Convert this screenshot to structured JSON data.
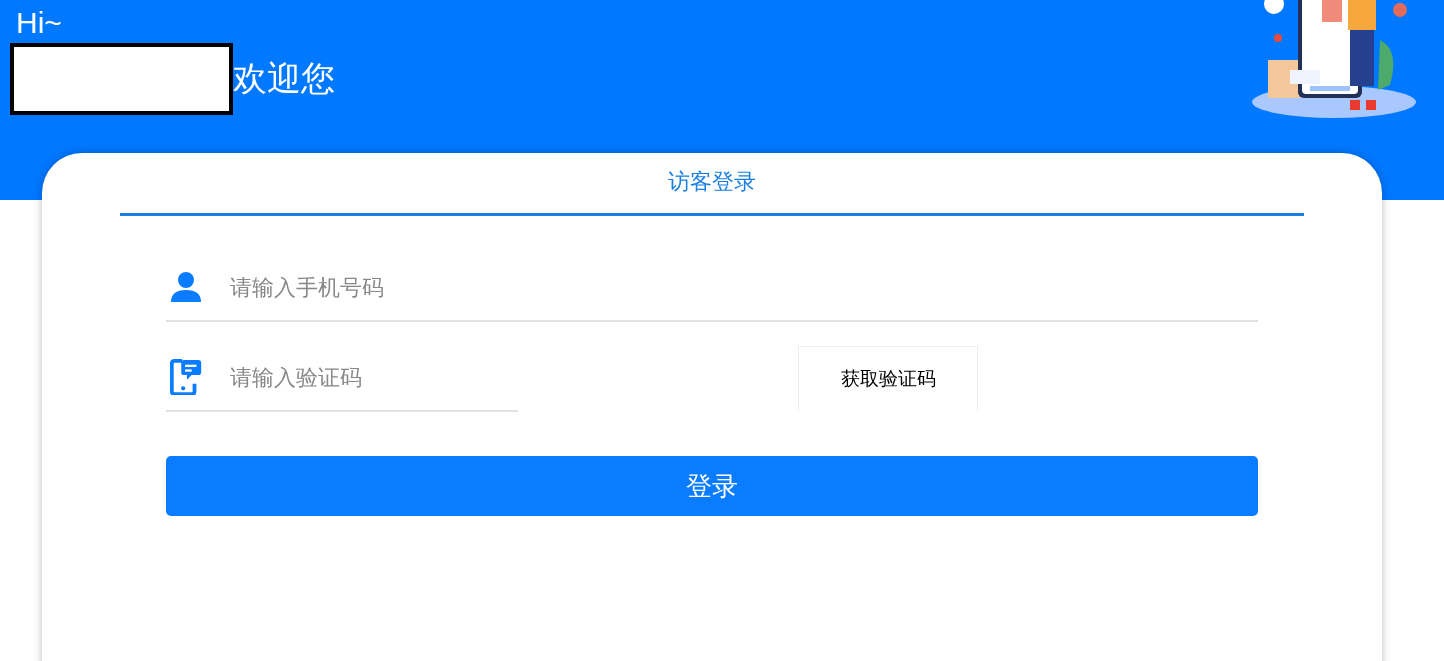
{
  "header": {
    "greeting": "Hi~",
    "welcome": "欢迎您"
  },
  "tabs": [
    {
      "label": "访客登录",
      "selected": true
    }
  ],
  "fields": [
    {
      "kind": "phone",
      "placeholder": "请输入手机号码"
    },
    {
      "kind": "code",
      "placeholder": "请输入验证码",
      "button": "获取验证码"
    }
  ],
  "submit": "登录"
}
